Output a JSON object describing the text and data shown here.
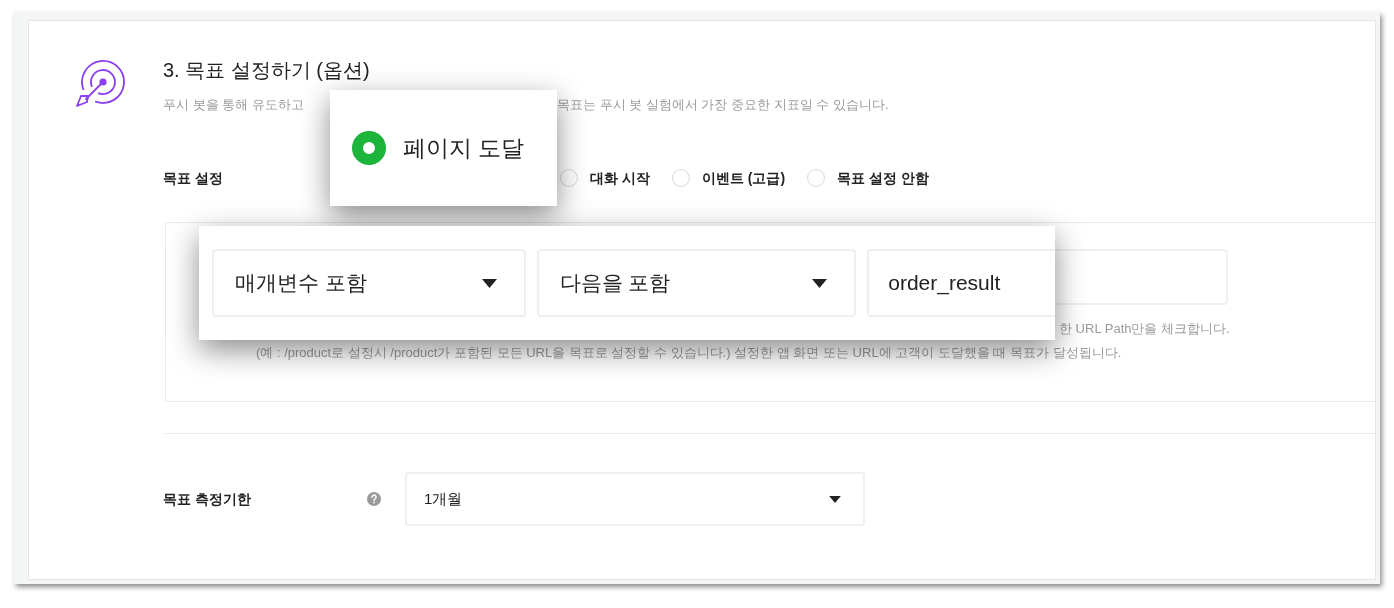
{
  "section": {
    "title": "3. 목표 설정하기 (옵션)",
    "description": [
      "푸시 봇을 통해 유도하고",
      "목표는 푸시 봇 실험에서 가장 중요한 지표일 수 있습니다."
    ]
  },
  "goal_setting": {
    "label": "목표 설정",
    "options": [
      {
        "label": "대화 시작",
        "selected": false
      },
      {
        "label": "이벤트 (고급)",
        "selected": false
      },
      {
        "label": "목표 설정 안함",
        "selected": false
      }
    ]
  },
  "url_condition": {
    "hint": [
      "한 URL Path만을 체크합니다.",
      "(예 : /product로 설정시 /product가 포함된 모든 URL을 목표로 설정할 수 있습니다.) 설정한 앱 화면 또는 URL에 고객이 도달했을 때 목표가 달성됩니다."
    ]
  },
  "measure_period": {
    "label": "목표 측정기한",
    "value": "1개월"
  },
  "callouts": [
    {
      "kind": "radio",
      "label": "페이지 도달",
      "selected": true
    },
    {
      "kind": "fields",
      "fields": [
        {
          "kind": "select",
          "value": "매개변수 포함"
        },
        {
          "kind": "select",
          "value": "다음을 포함"
        },
        {
          "kind": "input",
          "value": "order_result"
        }
      ]
    }
  ]
}
